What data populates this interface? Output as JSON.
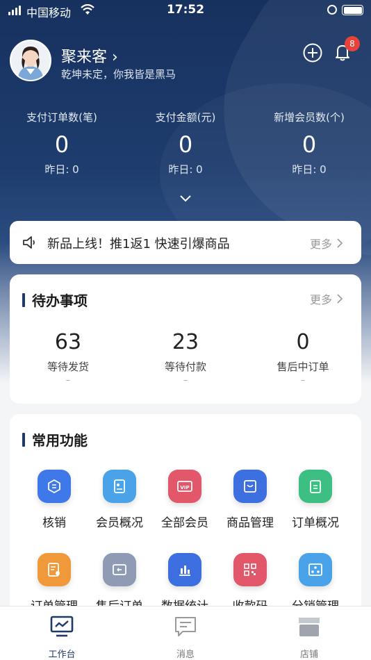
{
  "status_bar": {
    "carrier": "中国移动",
    "time": "17:52"
  },
  "profile": {
    "shop_name": "聚来客",
    "slogan": "乾坤未定，你我皆是黑马",
    "notification_count": "8"
  },
  "stats": [
    {
      "label": "支付订单数(笔)",
      "value": "0",
      "yesterday": "昨日: 0"
    },
    {
      "label": "支付金额(元)",
      "value": "0",
      "yesterday": "昨日: 0"
    },
    {
      "label": "新增会员数(个)",
      "value": "0",
      "yesterday": "昨日: 0"
    }
  ],
  "notice": {
    "text": "新品上线！推1返1 快速引爆商品",
    "more": "更多"
  },
  "todo": {
    "title": "待办事项",
    "more": "更多",
    "items": [
      {
        "count": "63",
        "label": "等待发货",
        "dash": "–"
      },
      {
        "count": "23",
        "label": "等待付款",
        "dash": "–"
      },
      {
        "count": "0",
        "label": "售后中订单",
        "dash": "–"
      }
    ]
  },
  "functions": {
    "title": "常用功能",
    "items": [
      {
        "label": "核销",
        "icon": "scan-icon",
        "color": "#3f78e8"
      },
      {
        "label": "会员概况",
        "icon": "member-card-icon",
        "color": "#4aa3e8"
      },
      {
        "label": "全部会员",
        "icon": "vip-card-icon",
        "color": "#e3576a"
      },
      {
        "label": "商品管理",
        "icon": "product-bag-icon",
        "color": "#3e6fe0"
      },
      {
        "label": "订单概况",
        "icon": "clipboard-icon",
        "color": "#3dbf83"
      },
      {
        "label": "订单管理",
        "icon": "order-edit-icon",
        "color": "#f0993a"
      },
      {
        "label": "售后订单",
        "icon": "return-icon",
        "color": "#8f9ab5"
      },
      {
        "label": "数据统计",
        "icon": "bar-chart-icon",
        "color": "#3e6fe0"
      },
      {
        "label": "收款码",
        "icon": "qr-code-icon",
        "color": "#e3576a"
      },
      {
        "label": "分销管理",
        "icon": "distribution-icon",
        "color": "#4aa3e8"
      }
    ]
  },
  "tabbar": [
    {
      "label": "工作台",
      "icon": "monitor-icon",
      "active": true
    },
    {
      "label": "消息",
      "icon": "message-icon",
      "active": false
    },
    {
      "label": "店铺",
      "icon": "store-icon",
      "active": false
    }
  ],
  "colors": {
    "primary": "#1f3a68",
    "badge": "#e8423b"
  }
}
